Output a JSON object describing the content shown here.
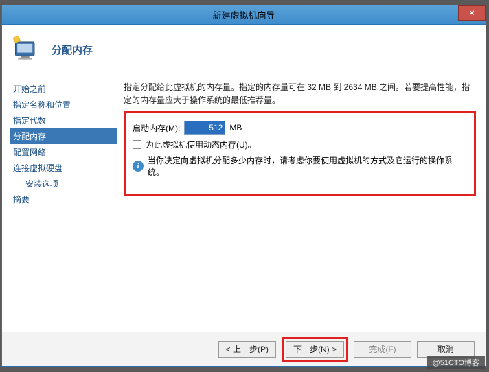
{
  "window": {
    "title": "新建虚拟机向导",
    "close_label": "×"
  },
  "header": {
    "page_title": "分配内存"
  },
  "sidebar": {
    "items": [
      {
        "label": "开始之前",
        "active": false
      },
      {
        "label": "指定名称和位置",
        "active": false
      },
      {
        "label": "指定代数",
        "active": false
      },
      {
        "label": "分配内存",
        "active": true
      },
      {
        "label": "配置网络",
        "active": false
      },
      {
        "label": "连接虚拟硬盘",
        "active": false
      },
      {
        "label": "安装选项",
        "active": false,
        "sub": true
      },
      {
        "label": "摘要",
        "active": false
      }
    ]
  },
  "content": {
    "description": "指定分配给此虚拟机的内存量。指定的内存量可在 32 MB 到 2634 MB 之间。若要提高性能，指定的内存量应大于操作系统的最低推荐量。",
    "startup_mem_label": "启动内存(M):",
    "startup_mem_value": "512",
    "mem_unit": "MB",
    "dynmem_label": "为此虚拟机使用动态内存(U)。",
    "info_text": "当你决定向虚拟机分配多少内存时，请考虑你要使用虚拟机的方式及它运行的操作系统。"
  },
  "footer": {
    "prev": "< 上一步(P)",
    "next": "下一步(N) >",
    "finish": "完成(F)",
    "cancel": "取消"
  },
  "watermark": "@51CTO博客"
}
